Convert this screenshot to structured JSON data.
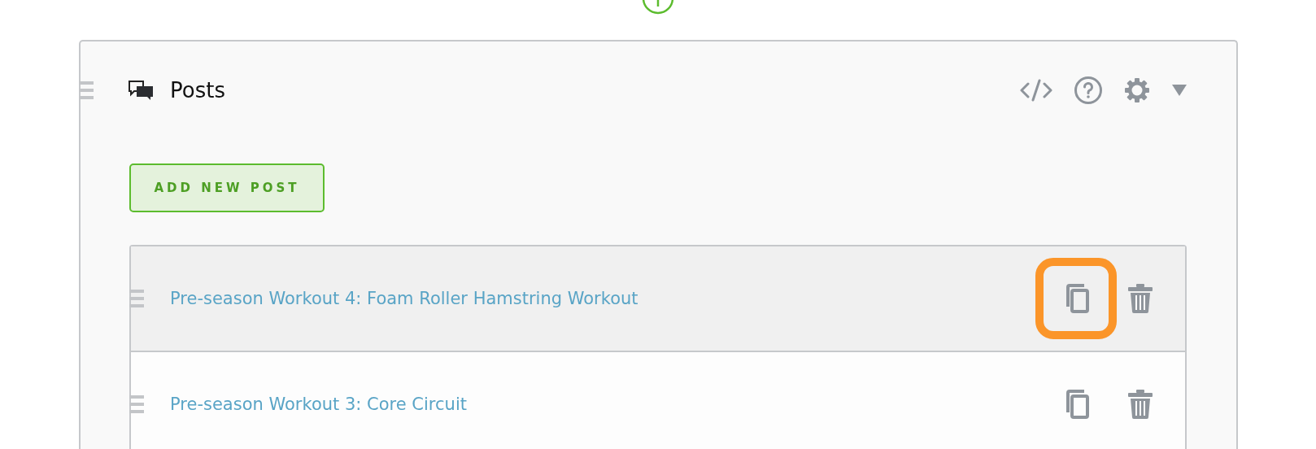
{
  "panel": {
    "title": "Posts"
  },
  "add_button": {
    "label": "ADD NEW POST"
  },
  "posts": [
    {
      "title": "Pre-season Workout 4: Foam Roller Hamstring Workout",
      "hovered": true,
      "copy_highlighted": true
    },
    {
      "title": "Pre-season Workout 3: Core Circuit",
      "hovered": false,
      "copy_highlighted": false
    }
  ]
}
